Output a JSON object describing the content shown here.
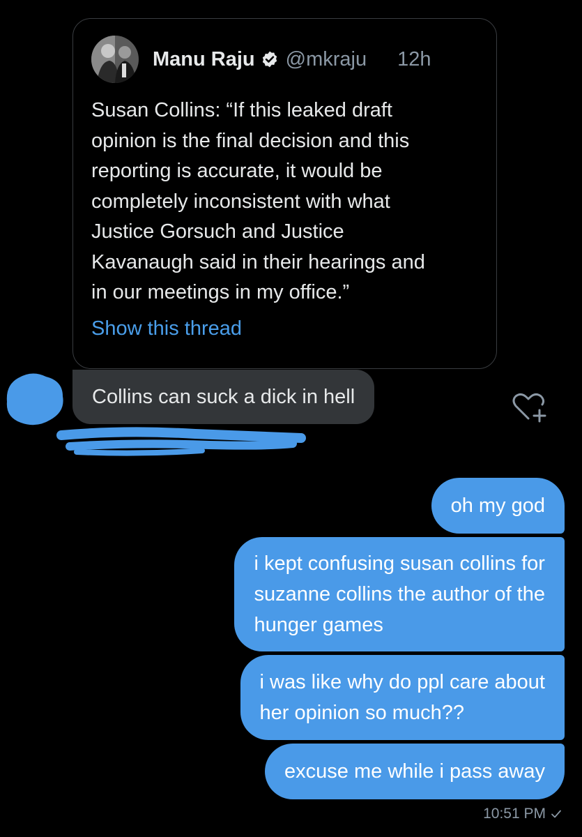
{
  "quoted_tweet": {
    "author_name": "Manu Raju",
    "handle": "@mkraju",
    "time": "12h",
    "text": "Susan Collins: “If this leaked draft\nopinion is the final decision and this\nreporting is accurate, it would be\ncompletely inconsistent with what\nJustice Gorsuch and Justice\nKavanaugh said in their hearings and\nin our meetings in my office.”",
    "show_thread_label": "Show this thread"
  },
  "received_message": {
    "text": "Collins can suck a dick in hell"
  },
  "sent_messages": [
    {
      "text": "oh my god"
    },
    {
      "text": "i kept confusing susan collins for\nsuzanne collins the author of the\nhunger games"
    },
    {
      "text": "i was like why do ppl care about\nher opinion so much??"
    },
    {
      "text": "excuse me while i pass away"
    }
  ],
  "timestamp": "10:51 PM",
  "colors": {
    "background": "#000000",
    "sent_bubble": "#4a9ae8",
    "received_bubble": "#333639",
    "link": "#4a9eea",
    "redaction": "#4a9ae8"
  },
  "icons": {
    "verified": "verified-badge-icon",
    "react": "heart-plus-icon",
    "read_receipt": "checkmark-icon"
  }
}
